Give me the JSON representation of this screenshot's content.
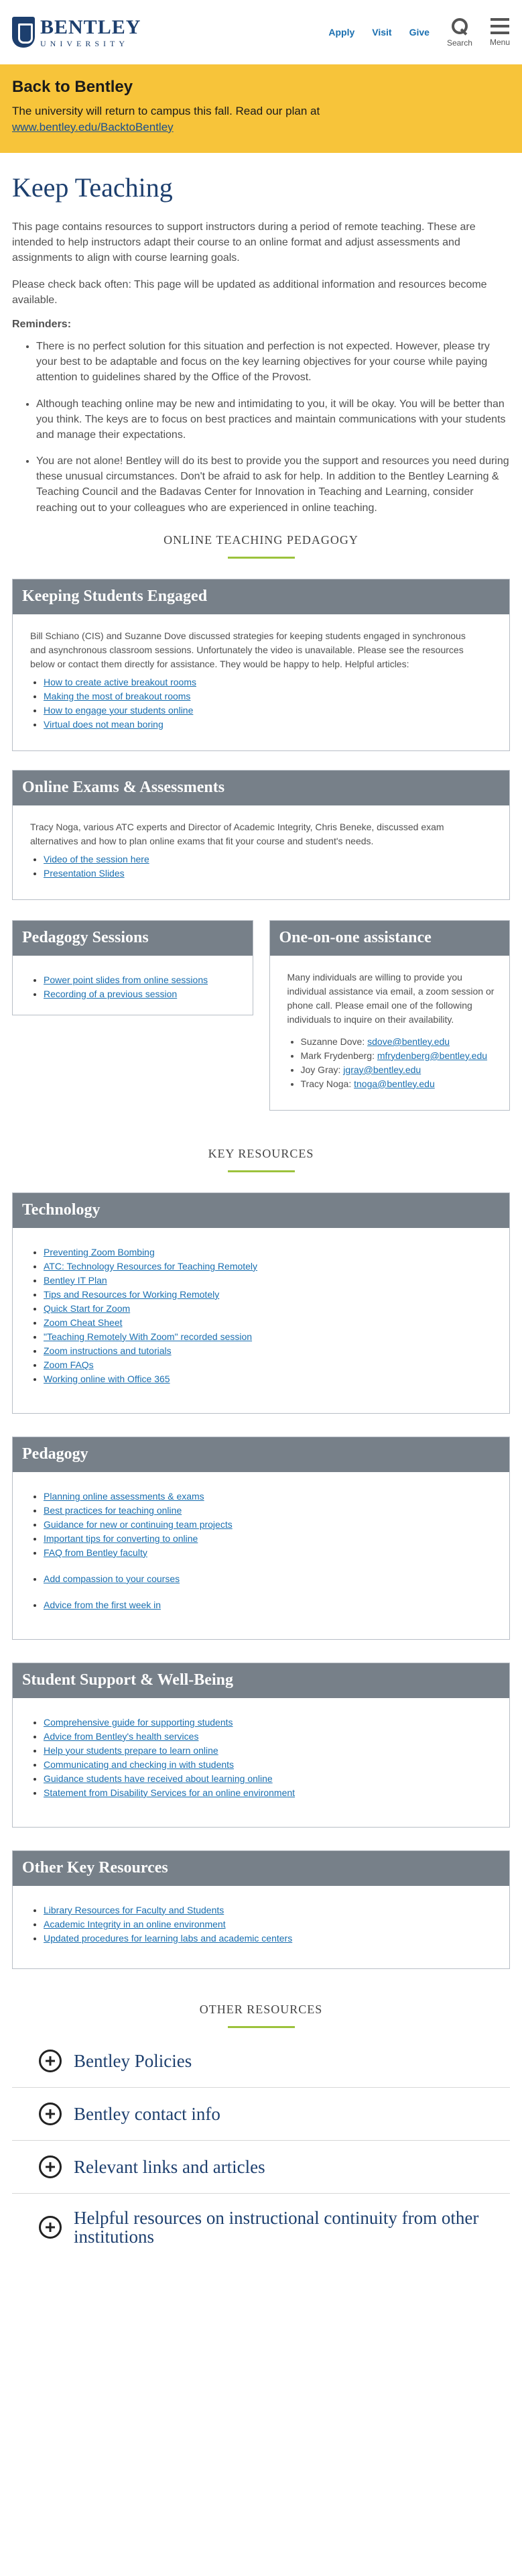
{
  "header": {
    "logo_main": "BENTLEY",
    "logo_sub": "UNIVERSITY",
    "nav": [
      "Apply",
      "Visit",
      "Give"
    ],
    "search_label": "Search",
    "menu_label": "Menu"
  },
  "banner": {
    "title": "Back to Bentley",
    "text": "The university will return to campus this fall. Read our plan at",
    "link": "www.bentley.edu/BacktoBentley"
  },
  "page_title": "Keep Teaching",
  "intro": [
    "This page contains resources to support instructors during a period of remote teaching. These are intended to help instructors adapt their course to an online format and adjust assessments and assignments to align with course learning goals.",
    "Please check back often: This page will be updated as additional information and resources become available."
  ],
  "reminders_title": "Reminders:",
  "reminders": [
    "There is no perfect solution for this situation and perfection is not expected.  However, please try your best to be adaptable and focus on the key learning objectives for your course while paying attention to guidelines shared by the Office of the Provost.",
    "Although teaching online may be new and intimidating to you, it will be okay.  You will be better than you think.  The keys are to focus on best practices and maintain communications with your students and manage their expectations.",
    "You are not alone!  Bentley will do its best to provide you the support and resources you need during these unusual circumstances. Don't be afraid to ask for help.  In addition to the Bentley Learning & Teaching Council and the Badavas Center for Innovation in Teaching and Learning, consider reaching out to your colleagues who are experienced in online teaching."
  ],
  "sections": {
    "pedagogy_heading": "ONLINE TEACHING PEDAGOGY",
    "key_heading": "KEY RESOURCES",
    "other_heading": "OTHER RESOURCES"
  },
  "engaged": {
    "title": "Keeping Students Engaged",
    "text": "Bill Schiano (CIS) and Suzanne Dove discussed strategies for keeping students engaged in synchronous and asynchronous classroom sessions. Unfortunately the video is unavailable. Please see the resources below or contact them directly for assistance. They would be happy to help.  Helpful articles:",
    "links": [
      "How to create active breakout rooms",
      "Making the most of breakout rooms",
      "How to engage your students online",
      "Virtual does not mean boring"
    ]
  },
  "exams": {
    "title": "Online Exams & Assessments",
    "text": "Tracy Noga, various ATC experts and Director of Academic Integrity, Chris Beneke, discussed exam alternatives and how to plan online exams that fit your course and student's needs.",
    "links": [
      "Video of the session here",
      "Presentation Slides"
    ]
  },
  "pedagogy_sessions": {
    "title": "Pedagogy Sessions",
    "links": [
      "Power point slides from online sessions",
      "Recording of a previous session"
    ]
  },
  "one_on_one": {
    "title": "One-on-one assistance",
    "text": "Many individuals are willing to provide you individual assistance via email, a zoom session or phone call.  Please email one of the following individuals to inquire on their availability.",
    "contacts": [
      {
        "name": "Suzanne Dove:",
        "email": "sdove@bentley.edu"
      },
      {
        "name": "Mark Frydenberg:",
        "email": "mfrydenberg@bentley.edu"
      },
      {
        "name": "Joy Gray:",
        "email": "jgray@bentley.edu"
      },
      {
        "name": "Tracy Noga:",
        "email": "tnoga@bentley.edu"
      }
    ]
  },
  "technology": {
    "title": "Technology",
    "links": [
      "Preventing Zoom Bombing",
      "ATC: Technology Resources for Teaching Remotely",
      "Bentley IT Plan",
      "Tips and Resources for Working Remotely",
      "Quick Start for Zoom",
      "Zoom Cheat Sheet",
      "\"Teaching Remotely With Zoom\" recorded session",
      "Zoom instructions and tutorials",
      "Zoom FAQs",
      "Working online with Office 365"
    ]
  },
  "pedagogy": {
    "title": "Pedagogy",
    "links": [
      "Planning online assessments & exams",
      "Best practices for teaching online",
      "Guidance for new or continuing team projects",
      "Important tips for converting to online",
      "FAQ from Bentley faculty"
    ],
    "extra_links": [
      "Add compassion to your courses",
      "Advice from the first week in"
    ]
  },
  "support": {
    "title": "Student Support & Well-Being",
    "links": [
      "Comprehensive guide for supporting students",
      "Advice from Bentley's health services",
      "Help your students prepare to learn online",
      "Communicating and checking in with students",
      "Guidance students have received about learning online",
      "Statement from Disability Services for an online environment"
    ]
  },
  "other_key": {
    "title": "Other Key Resources",
    "links": [
      "Library Resources for Faculty and Students",
      "Academic Integrity in an online environment",
      "Updated procedures for learning labs and academic centers"
    ]
  },
  "accordion": [
    "Bentley Policies",
    "Bentley contact info",
    "Relevant links and articles",
    "Helpful resources on instructional continuity from other institutions"
  ],
  "colors": {
    "navy": "#1d3f6e",
    "banner_yellow": "#f7c43a",
    "card_header_gray": "#778089",
    "accent_green": "#9cc23c",
    "link_blue": "#1a6fb0"
  }
}
